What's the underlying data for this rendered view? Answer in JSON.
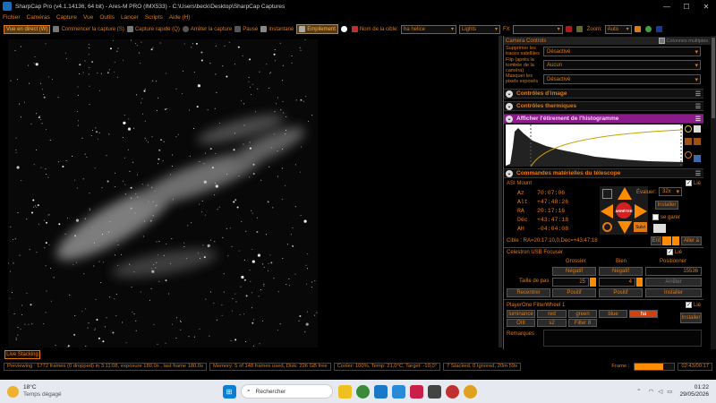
{
  "titlebar": {
    "title": "SharpCap Pro (v4.1.14136, 64 bit) - Ares-M PRO (IMX533) - C:\\Users\\beck\\Desktop\\SharpCap Captures",
    "minimize": "—",
    "maximize": "☐",
    "close": "✕"
  },
  "menu": [
    "Fichier",
    "Caméras",
    "Capture",
    "Vue",
    "Outils",
    "Lancer",
    "Scripts",
    "Aide (H)"
  ],
  "toolbar": {
    "live": "Vue en direct (W)",
    "start_capture": "Commencer la capture (S)",
    "quick_capture": "Capture rapide (Q)",
    "stop_capture": "Arrêter la capture",
    "pause": "Pause",
    "snapshot": "Instantané",
    "stacking": "Empilement",
    "target_label": "Nom de la cible:",
    "target_value": "ha helice",
    "frame_type": "Lights",
    "fx_label": "FX",
    "zoom_label": "Zoom:",
    "zoom_value": "Auto"
  },
  "camera_controls": {
    "header": "Camera Controls",
    "multi_columns": "Colonnes multiples",
    "rows": [
      {
        "label": "Supprimer les traces satellites",
        "value": "Désactivé"
      },
      {
        "label": "Flip (après la tombée de la caméra)",
        "value": "Aucun"
      },
      {
        "label": "Masquer les pixels exposés",
        "value": "Désactivé"
      }
    ]
  },
  "sections": {
    "image_controls": "Contrôles d'image",
    "thermal": "Contrôles thermiques",
    "histogram": "Afficher l'étirement de l'histogramme",
    "telescope": "Commandes matérielles du télescope"
  },
  "mount": {
    "name": "ASI Mount",
    "linked": "Lié",
    "coords": [
      {
        "k": "Az",
        "v": "70:07:06"
      },
      {
        "k": "Alt",
        "v": "+47:48:26"
      },
      {
        "k": "RA",
        "v": "20:17:16"
      },
      {
        "k": "Déc",
        "v": "+43:47:18"
      },
      {
        "k": "AH",
        "v": "-04:04:08"
      }
    ],
    "evaluate_label": "Évaluer:",
    "evaluate_value": "32x",
    "install": "Installer",
    "park": "se garer",
    "stop": "ARRÊTER",
    "follow": "Suivi",
    "target_line": "Cible : RA=20:17:10,0,Dec=+43:47:18",
    "goto": "Aller à",
    "ent": "Ent"
  },
  "focuser": {
    "name": "Celestron USB Focuser",
    "linked": "Lié",
    "col_coarse": "Grossier",
    "col_fine": "Bien",
    "col_position": "Positionner",
    "neg": "Négatif",
    "position_value": "15536",
    "step_label": "Taille de pas",
    "coarse_step": "25",
    "fine_step": "4",
    "stop": "Arrêter",
    "reset": "Recentrer",
    "pos": "Positif",
    "install": "Installer"
  },
  "filterwheel": {
    "name": "PlayerOne FilterWheel 1",
    "linked": "Lié",
    "filters": [
      "luminance",
      "red",
      "green",
      "blue",
      "ha",
      "OIII",
      "s2",
      "Filter 8"
    ],
    "selected": "ha",
    "install": "Installer"
  },
  "remarks": "Remarques",
  "live_stacking": "Live Stacking",
  "status": {
    "preview": "Previewing : 1772 frames (0 dropped) in 3:11:08, exposure 180,0s , last frame 180,0s",
    "memory": "Memory: 5 of 148 frames used, Disk: 226 GB free",
    "cooler": "Cooler: 100%, Temp: 21,0°C, Target: -10,0°",
    "stacked": "7 Stacked, 0 Ignored, 20m 59s",
    "frame_label": "Frame :",
    "frame_time": "02:43/00:17",
    "frame_progress": 0.72
  },
  "taskbar": {
    "weather_temp": "18°C",
    "weather_desc": "Temps dégagé",
    "search": "Rechercher",
    "time": "01:22",
    "date": "29/05/2026"
  },
  "colors": {
    "accent": "#e07a10",
    "histogram_header": "#8b1a8b",
    "stop_button": "#d32020",
    "status_progress": "#ff8c00"
  }
}
